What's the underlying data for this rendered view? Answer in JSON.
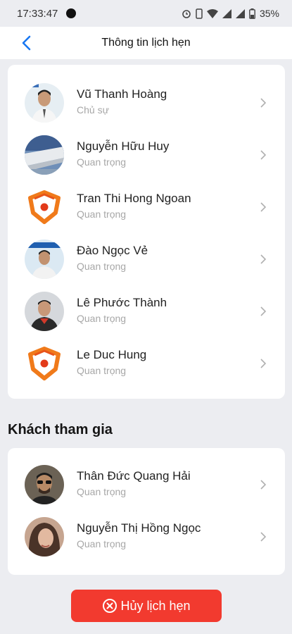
{
  "status_bar": {
    "time": "17:33:47",
    "battery": "35%"
  },
  "header": {
    "title": "Thông tin lịch hẹn"
  },
  "organizers": [
    {
      "name": "Vũ Thanh Hoàng",
      "role": "Chủ sự",
      "avatar": "photo-man-white-shirt"
    },
    {
      "name": "Nguyễn Hữu Huy",
      "role": "Quan trọng",
      "avatar": "photo-airplane-wing"
    },
    {
      "name": "Tran Thi Hong Ngoan",
      "role": "Quan trọng",
      "avatar": "shield-logo"
    },
    {
      "name": "Đào Ngọc Vẻ",
      "role": "Quan trọng",
      "avatar": "photo-man-tech-backdrop"
    },
    {
      "name": "Lê Phước Thành",
      "role": "Quan trọng",
      "avatar": "photo-man-red-shirt"
    },
    {
      "name": "Le Duc Hung",
      "role": "Quan trọng",
      "avatar": "shield-logo"
    }
  ],
  "guests_section": {
    "title": "Khách tham gia"
  },
  "guests": [
    {
      "name": "Thân Đức Quang Hải",
      "role": "Quan trọng",
      "avatar": "photo-man-sunglasses"
    },
    {
      "name": "Nguyễn Thị Hồng Ngọc",
      "role": "Quan trọng",
      "avatar": "photo-woman"
    }
  ],
  "actions": {
    "cancel_label": "Hủy lịch hẹn"
  },
  "colors": {
    "accent_blue": "#1877f2",
    "cancel_red": "#f23a2f",
    "shield_orange": "#f07a1a"
  }
}
